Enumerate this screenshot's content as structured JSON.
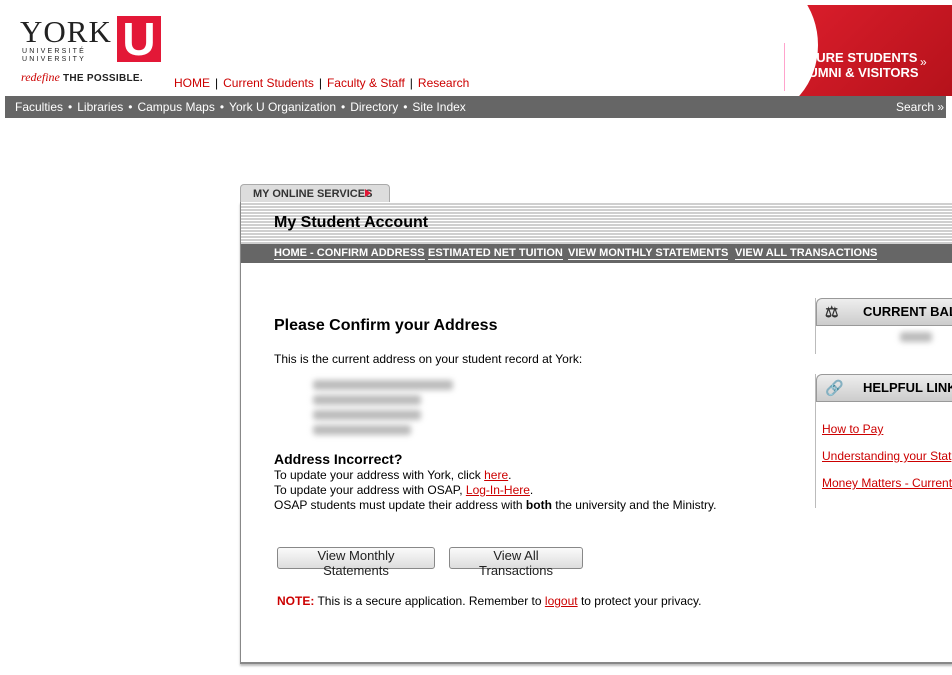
{
  "header": {
    "logo": {
      "york": "YORK",
      "u": "U",
      "universite": "UNIVERSITÉ",
      "university": "UNIVERSITY",
      "tag_red": "redefine",
      "tag_black": "THE POSSIBLE."
    },
    "top_links": [
      "HOME",
      "Current Students",
      "Faculty & Staff",
      "Research"
    ],
    "banner": {
      "line1": "FUTURE STUDENTS",
      "line2": "ALUMNI & VISITORS",
      "arrows": "»"
    }
  },
  "nav": {
    "items": [
      "Faculties",
      "Libraries",
      "Campus Maps",
      "York U Organization",
      "Directory",
      "Site Index"
    ],
    "search": "Search »"
  },
  "tab": {
    "label": "MY ONLINE SERVICES"
  },
  "account": {
    "title": "My Student Account",
    "subnav": [
      "HOME - CONFIRM ADDRESS",
      "ESTIMATED NET TUITION",
      "VIEW MONTHLY STATEMENTS",
      "VIEW ALL TRANSACTIONS"
    ]
  },
  "main": {
    "confirm_title": "Please Confirm your Address",
    "intro": "This is the current address on your student record at York:",
    "incorrect_title": "Address Incorrect?",
    "york_line_pre": "To update your address with York, click ",
    "york_link": "here",
    "york_line_post": ".",
    "osap_line_pre": "To update your address with OSAP, ",
    "osap_link": "Log-In-Here",
    "osap_line_post": ".",
    "osap_note_pre": "OSAP students must update their address with ",
    "osap_note_bold": "both",
    "osap_note_post": " the university and the Ministry.",
    "btn_monthly": "View Monthly Statements",
    "btn_all": "View All Transactions",
    "note_label": "NOTE:",
    "note_pre": " This is a secure application. Remember to ",
    "note_link": "logout",
    "note_post": " to protect your privacy."
  },
  "side": {
    "balance_title": "CURRENT BALA",
    "links_title": "HELPFUL LINK",
    "links": [
      "How to Pay",
      "Understanding your Stat",
      "Money Matters - Current"
    ]
  }
}
